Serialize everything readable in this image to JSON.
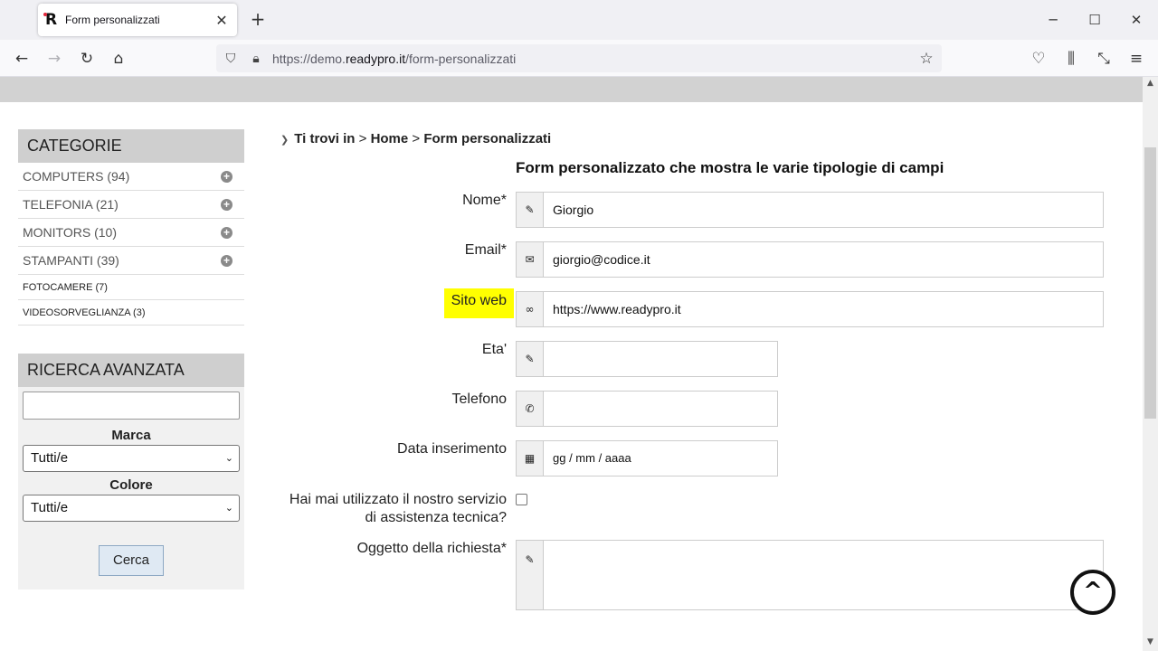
{
  "browser": {
    "tab_title": "Form personalizzati",
    "tab_close": "✕",
    "new_tab": "+",
    "url_prefix": "https://demo.",
    "url_domain": "readypro.it",
    "url_path": "/form-personalizzati"
  },
  "categories": {
    "title": "CATEGORIE",
    "items": [
      {
        "label": "COMPUTERS (94)"
      },
      {
        "label": "TELEFONIA (21)"
      },
      {
        "label": "MONITORS (10)"
      },
      {
        "label": "STAMPANTI (39)"
      },
      {
        "label": "FOTOCAMERE (7)"
      },
      {
        "label": "VIDEOSORVEGLIANZA (3)"
      }
    ]
  },
  "advanced_search": {
    "title": "RICERCA AVANZATA",
    "input_value": "",
    "brand_label": "Marca",
    "brand_value": "Tutti/e",
    "color_label": "Colore",
    "color_value": "Tutti/e",
    "button_label": "Cerca"
  },
  "breadcrumb": {
    "prefix": "Ti trovi in",
    "sep": ">",
    "home": "Home",
    "current": "Form personalizzati"
  },
  "form": {
    "title": "Form personalizzato che mostra le varie tipologie di campi",
    "name_label": "Nome*",
    "name_value": "Giorgio",
    "email_label": "Email*",
    "email_value": "giorgio@codice.it",
    "website_label": "Sito web",
    "website_value": "https://www.readypro.it",
    "age_label": "Eta'",
    "age_value": "",
    "phone_label": "Telefono",
    "phone_value": "",
    "date_label": "Data inserimento",
    "date_placeholder": "gg / mm / aaaa",
    "support_label_line1": "Hai mai utilizzato il nostro servizio",
    "support_label_line2": "di assistenza tecnica?",
    "subject_label": "Oggetto della richiesta*",
    "subject_value": ""
  },
  "colors": {
    "highlight": "#ffff00",
    "sidebar_header": "#cfcfcf",
    "button": "#dfe9f3"
  }
}
